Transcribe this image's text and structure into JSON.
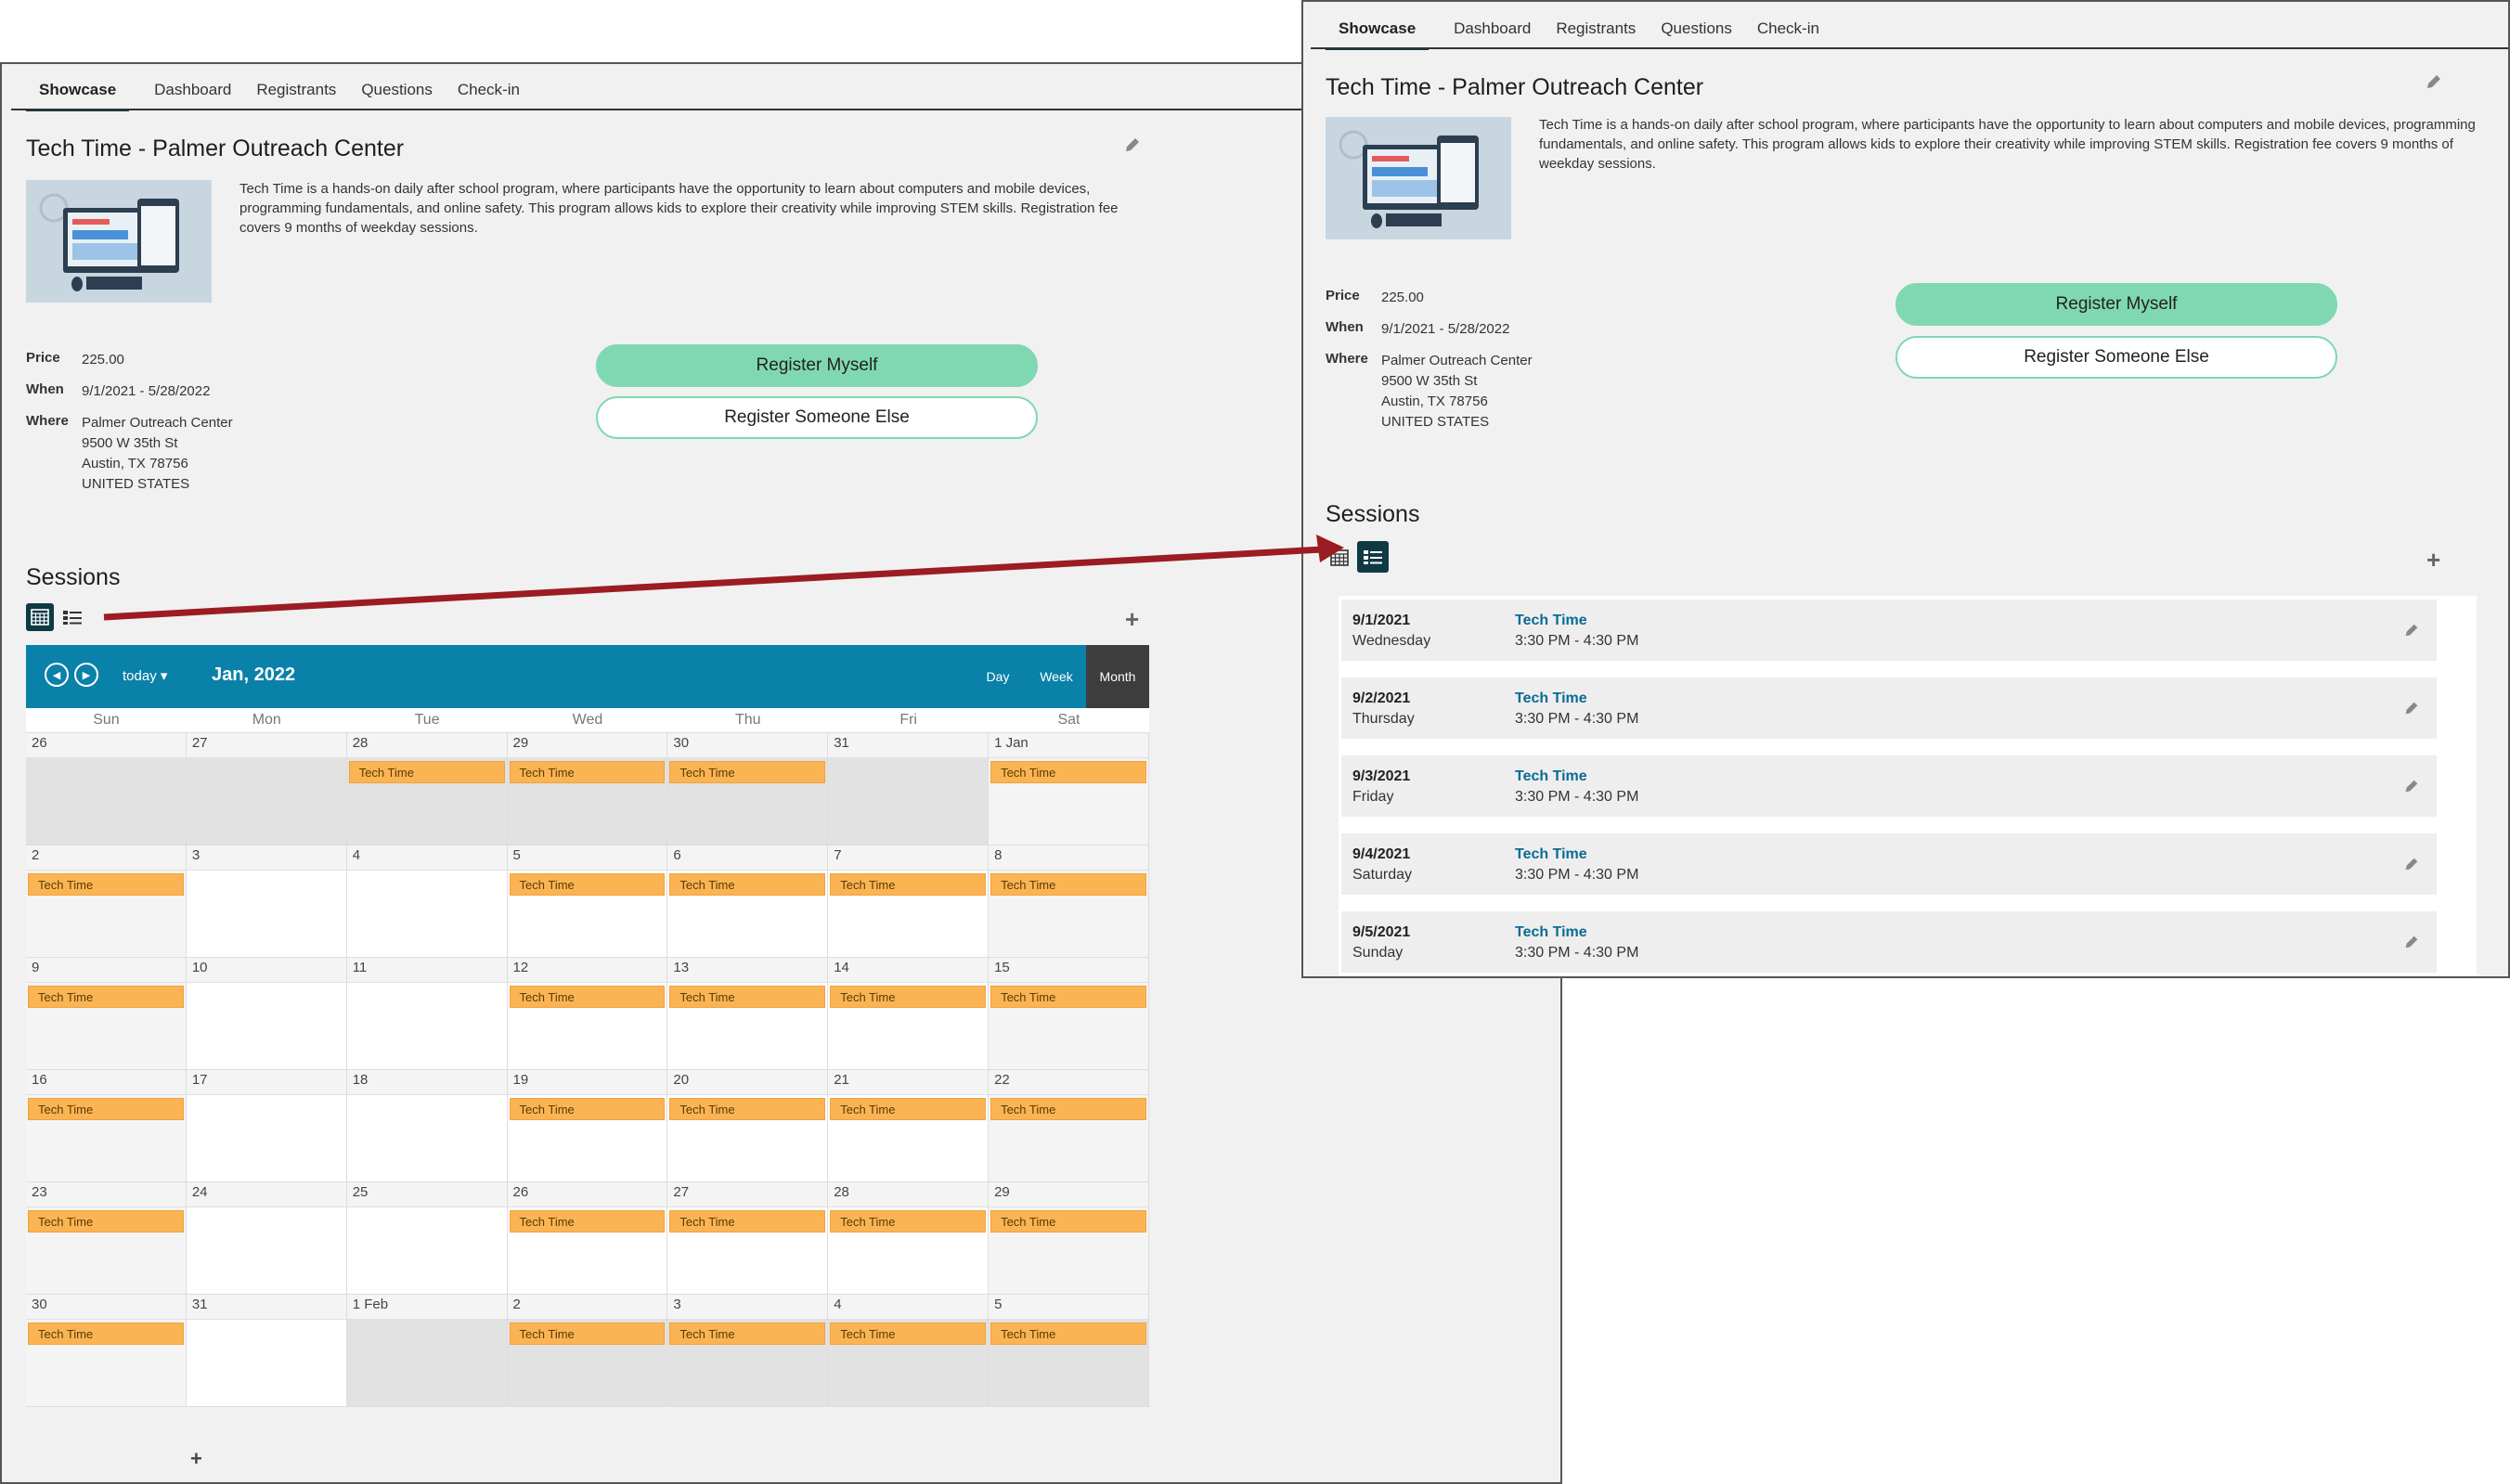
{
  "tabs": [
    "Showcase",
    "Dashboard",
    "Registrants",
    "Questions",
    "Check-in"
  ],
  "event": {
    "title": "Tech Time - Palmer Outreach Center",
    "description": "Tech Time is a hands-on daily after school program, where participants have the opportunity to learn about computers and mobile devices, programming fundamentals, and online safety. This program allows kids to explore their creativity while improving STEM skills. Registration fee covers 9 months of weekday sessions.",
    "price_label": "Price",
    "price": "225.00",
    "when_label": "When",
    "when": "9/1/2021 - 5/28/2022",
    "where_label": "Where",
    "where": [
      "Palmer Outreach Center",
      "9500 W 35th St",
      "Austin, TX 78756",
      "UNITED STATES"
    ],
    "register_myself": "Register Myself",
    "register_someone": "Register Someone Else"
  },
  "sessions_title": "Sessions",
  "calendar": {
    "today": "today ▾",
    "title": "Jan, 2022",
    "views": [
      "Day",
      "Week",
      "Month"
    ],
    "active_view": "Month",
    "dow": [
      "Sun",
      "Mon",
      "Tue",
      "Wed",
      "Thu",
      "Fri",
      "Sat"
    ],
    "weeks": [
      [
        {
          "n": "26",
          "o": true
        },
        {
          "n": "27",
          "o": true
        },
        {
          "n": "28",
          "o": true,
          "e": "Tech Time"
        },
        {
          "n": "29",
          "o": true,
          "e": "Tech Time"
        },
        {
          "n": "30",
          "o": true,
          "e": "Tech Time"
        },
        {
          "n": "31",
          "o": true
        },
        {
          "n": "1 Jan",
          "e": "Tech Time",
          "w": true
        }
      ],
      [
        {
          "n": "2",
          "e": "Tech Time",
          "w": true
        },
        {
          "n": "3"
        },
        {
          "n": "4"
        },
        {
          "n": "5",
          "e": "Tech Time"
        },
        {
          "n": "6",
          "e": "Tech Time"
        },
        {
          "n": "7",
          "e": "Tech Time"
        },
        {
          "n": "8",
          "e": "Tech Time",
          "w": true
        }
      ],
      [
        {
          "n": "9",
          "e": "Tech Time",
          "w": true
        },
        {
          "n": "10"
        },
        {
          "n": "11"
        },
        {
          "n": "12",
          "e": "Tech Time"
        },
        {
          "n": "13",
          "e": "Tech Time"
        },
        {
          "n": "14",
          "e": "Tech Time"
        },
        {
          "n": "15",
          "e": "Tech Time",
          "w": true
        }
      ],
      [
        {
          "n": "16",
          "e": "Tech Time",
          "w": true
        },
        {
          "n": "17"
        },
        {
          "n": "18"
        },
        {
          "n": "19",
          "e": "Tech Time"
        },
        {
          "n": "20",
          "e": "Tech Time"
        },
        {
          "n": "21",
          "e": "Tech Time"
        },
        {
          "n": "22",
          "e": "Tech Time",
          "w": true
        }
      ],
      [
        {
          "n": "23",
          "e": "Tech Time",
          "w": true
        },
        {
          "n": "24"
        },
        {
          "n": "25"
        },
        {
          "n": "26",
          "e": "Tech Time"
        },
        {
          "n": "27",
          "e": "Tech Time"
        },
        {
          "n": "28",
          "e": "Tech Time"
        },
        {
          "n": "29",
          "e": "Tech Time",
          "w": true
        }
      ],
      [
        {
          "n": "30",
          "e": "Tech Time",
          "w": true
        },
        {
          "n": "31"
        },
        {
          "n": "1 Feb",
          "o": true
        },
        {
          "n": "2",
          "o": true,
          "e": "Tech Time"
        },
        {
          "n": "3",
          "o": true,
          "e": "Tech Time"
        },
        {
          "n": "4",
          "o": true,
          "e": "Tech Time"
        },
        {
          "n": "5",
          "o": true,
          "e": "Tech Time"
        }
      ]
    ]
  },
  "session_list": [
    {
      "date": "9/1/2021",
      "day": "Wednesday",
      "name": "Tech Time",
      "time": "3:30 PM - 4:30 PM"
    },
    {
      "date": "9/2/2021",
      "day": "Thursday",
      "name": "Tech Time",
      "time": "3:30 PM - 4:30 PM"
    },
    {
      "date": "9/3/2021",
      "day": "Friday",
      "name": "Tech Time",
      "time": "3:30 PM - 4:30 PM"
    },
    {
      "date": "9/4/2021",
      "day": "Saturday",
      "name": "Tech Time",
      "time": "3:30 PM - 4:30 PM"
    },
    {
      "date": "9/5/2021",
      "day": "Sunday",
      "name": "Tech Time",
      "time": "3:30 PM - 4:30 PM"
    }
  ],
  "colors": {
    "accent": "#80d8b2",
    "calendar_header": "#0a81a9",
    "event": "#fbb454",
    "dark_teal": "#0f3a44",
    "arrow": "#9b1c22"
  }
}
